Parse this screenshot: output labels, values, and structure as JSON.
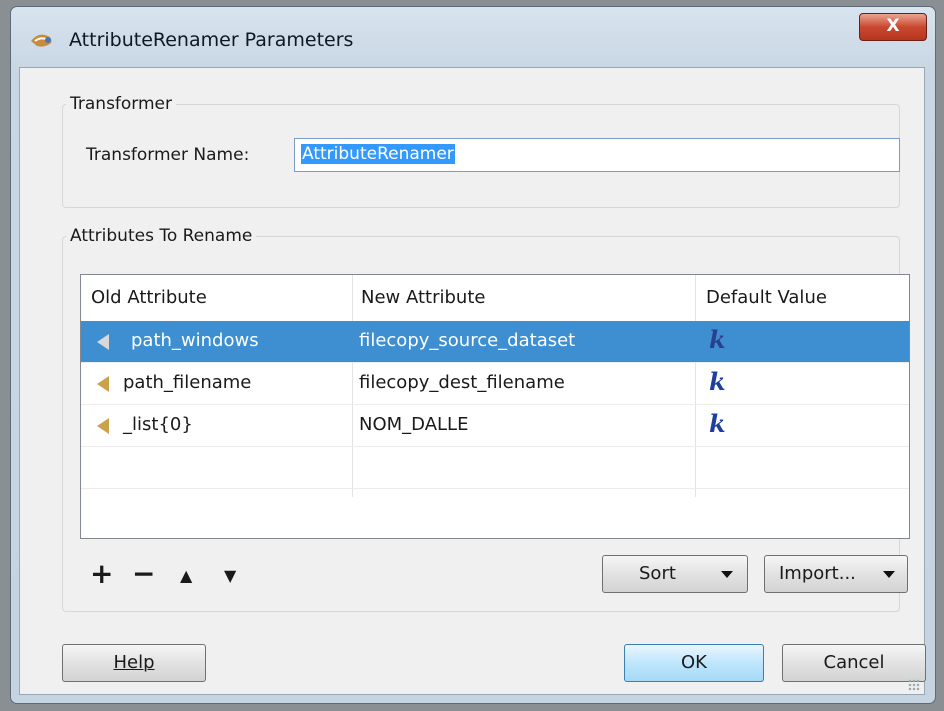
{
  "window": {
    "title": "AttributeRenamer Parameters",
    "close_label": "X"
  },
  "transformer": {
    "group_title": "Transformer",
    "name_label": "Transformer Name:",
    "name_value": "AttributeRenamer"
  },
  "attributes": {
    "group_title": "Attributes To Rename",
    "columns": [
      "Old Attribute",
      "New Attribute",
      "Default Value"
    ],
    "rows": [
      {
        "old": "path_windows",
        "new": "filecopy_source_dataset",
        "default": "k",
        "selected": true
      },
      {
        "old": "path_filename",
        "new": "filecopy_dest_filename",
        "default": "k",
        "selected": false
      },
      {
        "old": "_list{0}",
        "new": "NOM_DALLE",
        "default": "k",
        "selected": false
      }
    ],
    "toolbar": {
      "add": "+",
      "remove": "−",
      "up": "▲",
      "down": "▼"
    },
    "sort_label": "Sort",
    "import_label": "Import..."
  },
  "footer": {
    "help_label": "Help",
    "ok_label": "OK",
    "cancel_label": "Cancel"
  },
  "icons": {
    "app": "fme-workbench-icon",
    "attribute": "attribute-arrow-icon",
    "default_value": "k-text-editor-icon"
  },
  "colors": {
    "selection": "#3d8fd1",
    "close": "#c9492f",
    "attribute_icon": "#c9a24b"
  }
}
